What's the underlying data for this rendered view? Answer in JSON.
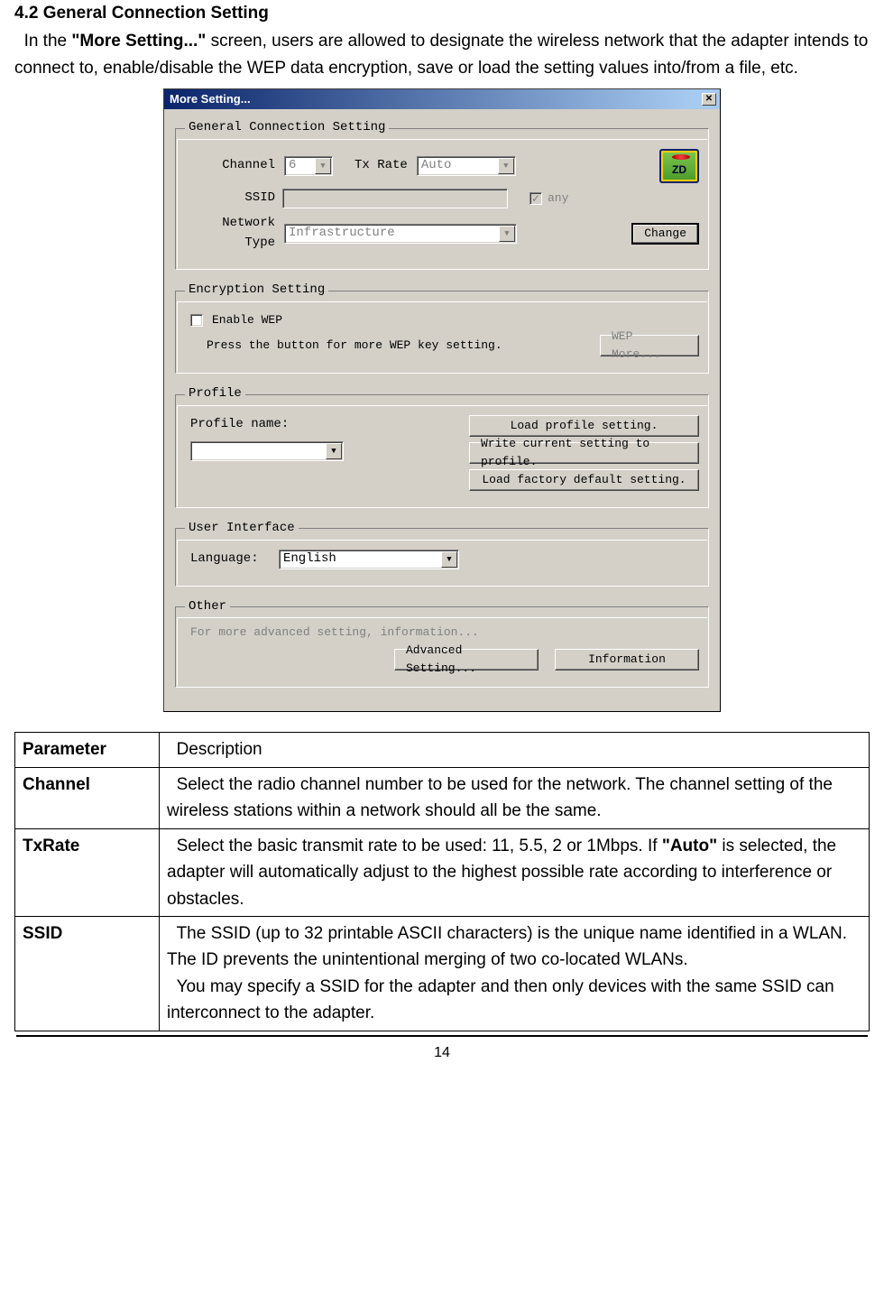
{
  "doc": {
    "section_number": "4.2 General Connection Setting",
    "intro_pre": "In the ",
    "intro_q": "\"More Setting...\"",
    "intro_post": " screen, users are allowed to designate the wireless network that the adapter intends to connect to, enable/disable the WEP data encryption, save or load the setting values into/from a file, etc."
  },
  "window": {
    "title": "More Setting...",
    "close_x": "✕",
    "groups": {
      "general": {
        "legend": "General Connection Setting",
        "channel_label": "Channel",
        "channel_value": "6",
        "txrate_label": "Tx Rate",
        "txrate_value": "Auto",
        "ssid_label": "SSID",
        "ssid_value": "",
        "any_label": "any",
        "nettype_label": "Network Type",
        "nettype_value": "Infrastructure",
        "change_btn": "Change"
      },
      "encryption": {
        "legend": "Encryption Setting",
        "enable_wep": "Enable WEP",
        "hint": "Press the button for more WEP key setting.",
        "wep_more_btn": "WEP More..."
      },
      "profile": {
        "legend": "Profile",
        "name_label": "Profile name:",
        "name_value": "",
        "btn_load": "Load profile setting.",
        "btn_write": "Write current setting to profile.",
        "btn_factory": "Load factory default setting."
      },
      "ui": {
        "legend": "User Interface",
        "lang_label": "Language:",
        "lang_value": "English"
      },
      "other": {
        "legend": "Other",
        "hint": "For more advanced setting, information...",
        "btn_adv": "Advanced Setting...",
        "btn_info": "Information"
      }
    }
  },
  "table": {
    "header": {
      "param": "Parameter",
      "desc": "Description"
    },
    "rows": [
      {
        "param": "Channel",
        "desc": "Select the radio channel number to be used for the network. The channel setting of the wireless stations within a network should all be the same."
      },
      {
        "param": "TxRate",
        "desc_pre": "Select the basic transmit rate to be used: 11, 5.5, 2 or 1Mbps. If ",
        "desc_b": "\"Auto\"",
        "desc_post": " is selected, the adapter will automatically adjust to the highest possible rate according to interference or obstacles."
      },
      {
        "param": "SSID",
        "desc_p1": "The SSID (up to 32 printable ASCII characters) is the unique name identified in a WLAN. The ID prevents the unintentional merging of two co-located WLANs.",
        "desc_p2": "You may specify a SSID for the adapter and then only devices with the same SSID can interconnect to the adapter."
      }
    ]
  },
  "page_number": "14"
}
